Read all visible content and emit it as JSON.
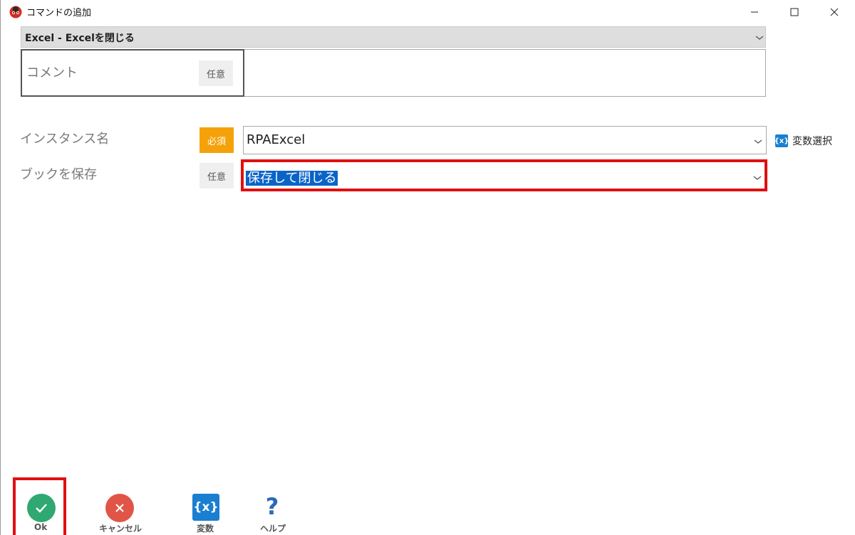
{
  "window": {
    "title": "コマンドの追加",
    "icon": "ladybug-icon"
  },
  "command": {
    "selected": "Excel - Excelを閉じる"
  },
  "comment": {
    "label": "コメント",
    "badge": "任意",
    "value": ""
  },
  "fields": [
    {
      "label": "インスタンス名",
      "badge": "必須",
      "badge_type": "required",
      "value": "RPAExcel"
    },
    {
      "label": "ブックを保存",
      "badge": "任意",
      "badge_type": "optional",
      "value": "保存して閉じる"
    }
  ],
  "var_select": {
    "icon_text": "{x}",
    "label": "変数選択"
  },
  "toolbar": {
    "ok": "Ok",
    "cancel": "キャンセル",
    "variables": "変数",
    "variables_icon_text": "{x}",
    "help": "ヘルプ",
    "help_icon_text": "?"
  },
  "colors": {
    "required_badge": "#f5a20a",
    "ok_green": "#2fa872",
    "cancel_red": "#e05548",
    "variables_blue": "#1a7fd0",
    "help_blue": "#2c68b8",
    "highlight_red": "#e01010",
    "selection_blue": "#0a64c8"
  }
}
